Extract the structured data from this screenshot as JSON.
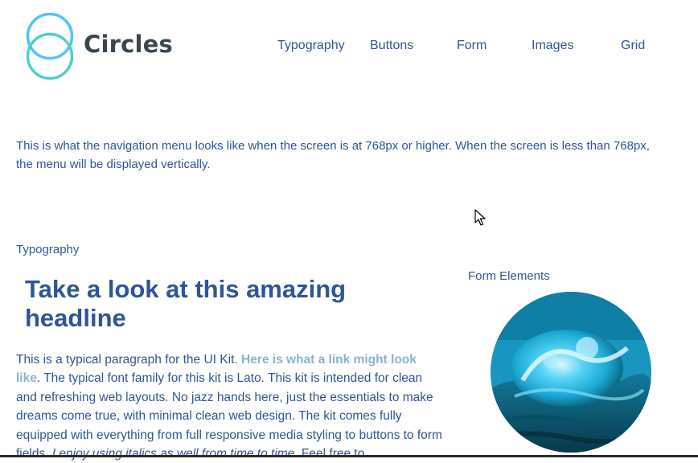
{
  "brand": {
    "name": "Circles"
  },
  "nav": {
    "items": [
      "Typography",
      "Buttons",
      "Form",
      "Images",
      "Grid"
    ]
  },
  "intro": {
    "text": "This is what the navigation menu looks like when the screen is at 768px or higher. When the screen is less than 768px, the menu will be displayed vertically."
  },
  "typography": {
    "section_label": "Typography",
    "headline": "Take a look at this amazing headline",
    "para_start": "This is a typical paragraph for the UI Kit. ",
    "link_text": "Here is what a link might look like",
    "para_middle": ". The typical font family for this kit is Lato. This kit is intended for clean and refreshing web layouts. No jazz hands here, just the essentials to make dreams come true, with minimal clean web design. The kit comes fully equipped with everything from full responsive media styling to buttons to form fields. ",
    "italic_text": "I enjoy using italics as well from time to time",
    "para_end": ". Feel free to"
  },
  "form_elements": {
    "section_label": "Form Elements"
  },
  "colors": {
    "text": "#2f5597",
    "link": "#8ab3cd",
    "logo_ring_top": "#4fc3f7",
    "logo_ring_bottom": "#4dd0c4",
    "logo_text": "#37474f"
  },
  "icons": {
    "logo": "two-overlapping-circles-logo",
    "cursor": "mouse-pointer-icon",
    "image": "ocean-wave-image"
  }
}
